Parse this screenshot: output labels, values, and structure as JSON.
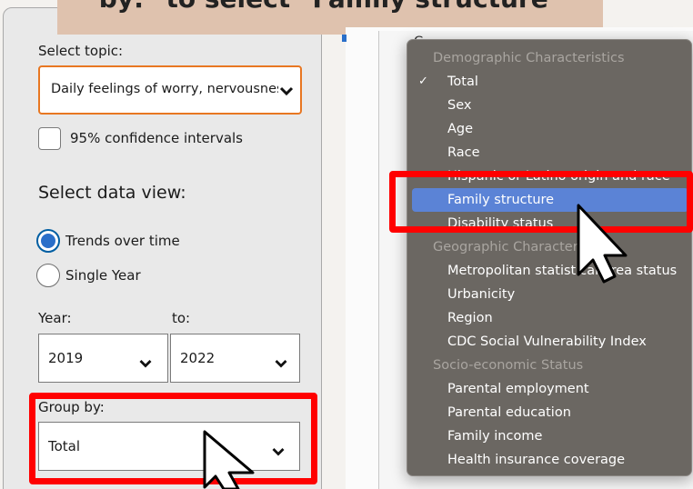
{
  "banner": {
    "text": "by:\" to select \"Family structure\""
  },
  "sidebar": {
    "topic_label": "Select topic:",
    "topic_value": "Daily feelings of worry, nervousness",
    "ci_label": "95% confidence intervals",
    "data_view_heading": "Select data view:",
    "view_options": [
      {
        "label": "Trends over time",
        "selected": true
      },
      {
        "label": "Single Year",
        "selected": false
      }
    ],
    "year_label": "Year:",
    "to_label": "to:",
    "year_from": "2019",
    "year_to": "2022",
    "group_by_label": "Group by:",
    "group_by_value": "Total"
  },
  "right_panel": {
    "peek_label": "G"
  },
  "dropdown": {
    "groups": [
      {
        "header": "Demographic Characteristics",
        "items": [
          "Total",
          "Sex",
          "Age",
          "Race",
          "Hispanic or Latino origin and race",
          "Family structure",
          "Disability status"
        ]
      },
      {
        "header": "Geographic Characteristics",
        "items": [
          "Metropolitan statistical area status",
          "Urbanicity",
          "Region",
          "CDC Social Vulnerability Index"
        ]
      },
      {
        "header": "Socio-economic Status",
        "items": [
          "Parental employment",
          "Parental education",
          "Family income",
          "Health insurance coverage"
        ]
      }
    ],
    "checked_item": "Total",
    "highlighted_item": "Family structure"
  },
  "colors": {
    "highlight_red": "#ff0000",
    "menu_bg": "#6b6762",
    "menu_highlight": "#5b83d6",
    "focus_orange": "#e87722",
    "banner_bg": "#dfc2ae"
  }
}
